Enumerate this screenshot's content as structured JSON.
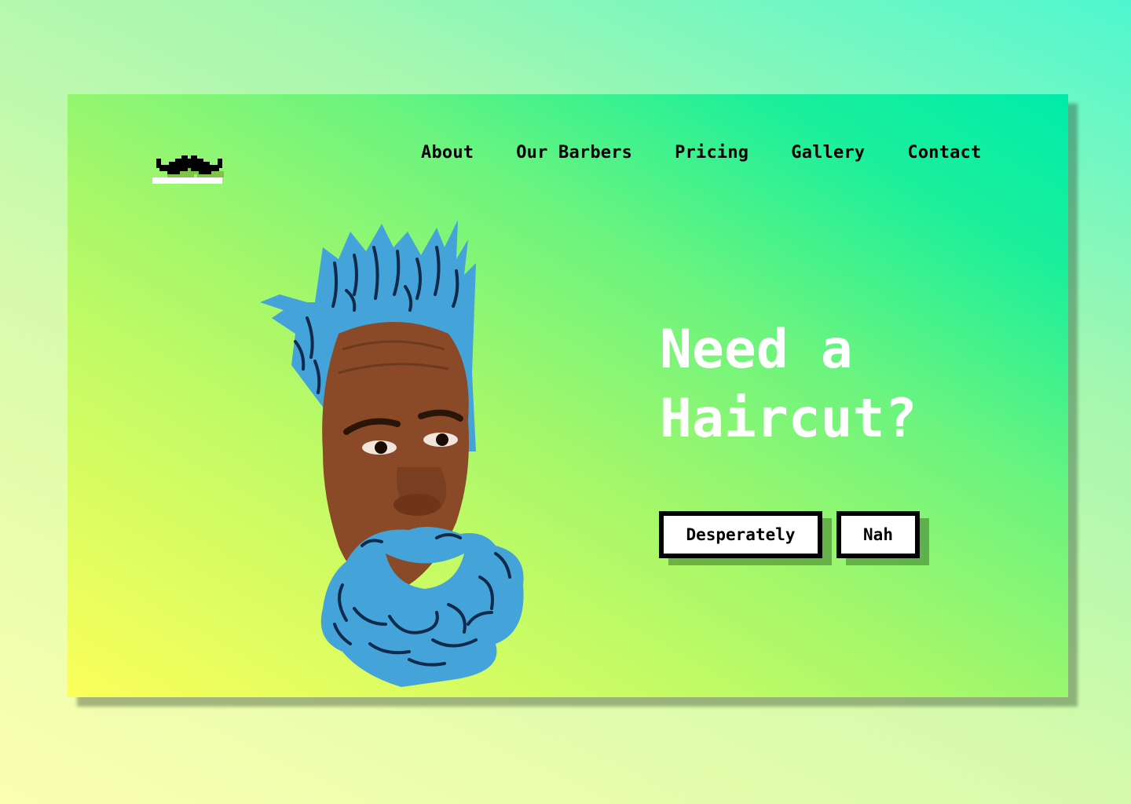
{
  "brand": {
    "logo_icon": "mustache-icon",
    "underline_color": "#ffffff"
  },
  "nav": {
    "items": [
      "About",
      "Our Barbers",
      "Pricing",
      "Gallery",
      "Contact"
    ]
  },
  "hero": {
    "headline": "Need a\nHaircut?",
    "primary_button": "Desperately",
    "secondary_button": "Nah",
    "illustration": "bearded-man-doodle-portrait"
  },
  "colors": {
    "page_bg_start": "#fcffb0",
    "page_bg_end": "#4ef7cf",
    "card_bg_start": "#fbff5a",
    "card_bg_end": "#00ecaa",
    "doodle_blue": "#44a3d8",
    "doodle_stroke": "#0f2a4a",
    "headline": "#ffffff"
  }
}
